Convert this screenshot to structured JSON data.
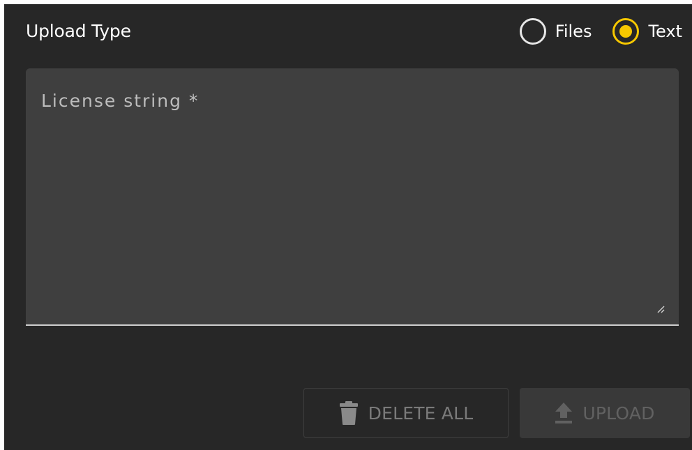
{
  "header": {
    "title": "Upload Type"
  },
  "upload_type": {
    "options": [
      {
        "label": "Files",
        "selected": false
      },
      {
        "label": "Text",
        "selected": true
      }
    ]
  },
  "license_field": {
    "label": "License string *",
    "value": ""
  },
  "actions": {
    "delete_label": "DELETE ALL",
    "upload_label": "UPLOAD"
  },
  "icons": {
    "delete": "trash-icon",
    "upload": "upload-arrow-icon",
    "resize": "resize-handle-icon"
  },
  "colors": {
    "background": "#272727",
    "field": "#3f3f3f",
    "accent": "#f7c800",
    "disabled_text": "#7a7a7a"
  }
}
